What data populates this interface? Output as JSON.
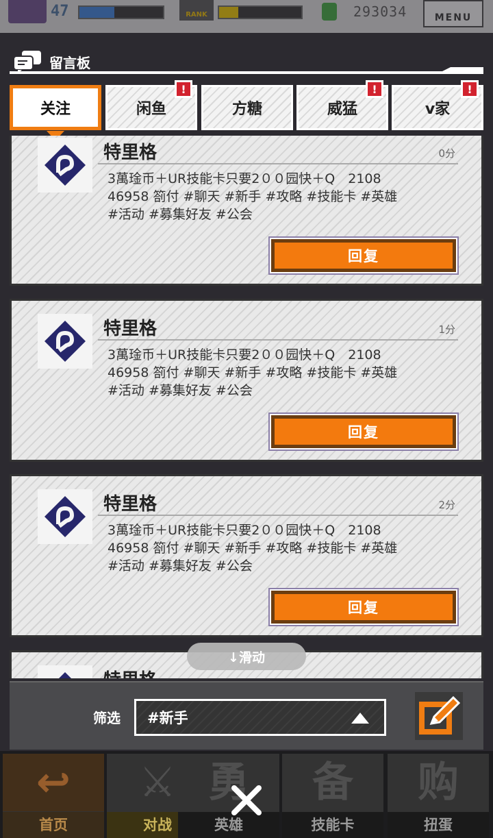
{
  "topbar": {
    "level": "47",
    "rank_label": "RANK",
    "money": "293034",
    "menu_label": "MENU",
    "exp_fill": 0.42,
    "rank_fill": 0.23
  },
  "board": {
    "title": "留言板"
  },
  "tabs": [
    {
      "label": "关注",
      "active": true,
      "alert": false
    },
    {
      "label": "闲鱼",
      "active": false,
      "alert": true
    },
    {
      "label": "方糖",
      "active": false,
      "alert": false
    },
    {
      "label": "威猛",
      "active": false,
      "alert": true
    },
    {
      "label": "v家",
      "active": false,
      "alert": true
    }
  ],
  "alert_glyph": "!",
  "posts": [
    {
      "name": "特里格",
      "time": "0分",
      "line1": "3萬琻币＋UR技能卡只要2００园快＋Q　2108",
      "line2": "46958 箚付 #聊天 #新手 #攻略 #技能卡 #英雄",
      "line3": "#活动 #募集好友 #公会",
      "reply_label": "回复"
    },
    {
      "name": "特里格",
      "time": "1分",
      "line1": "3萬琻币＋UR技能卡只要2００园快＋Q　2108",
      "line2": "46958 箚付 #聊天 #新手 #攻略 #技能卡 #英雄",
      "line3": "#活动 #募集好友 #公会",
      "reply_label": "回复"
    },
    {
      "name": "特里格",
      "time": "2分",
      "line1": "3萬琻币＋UR技能卡只要2００园快＋Q　2108",
      "line2": "46958 箚付 #聊天 #新手 #攻略 #技能卡 #英雄",
      "line3": "#活动 #募集好友 #公会",
      "reply_label": "回复"
    },
    {
      "name": "特里格",
      "time": "",
      "line1": "",
      "line2": "",
      "line3": "",
      "reply_label": ""
    }
  ],
  "scroll_hint": "↓滑动",
  "filter": {
    "label": "筛选",
    "selected": "#新手"
  },
  "nav": [
    {
      "label": "首页",
      "glyph": "↩"
    },
    {
      "label": "对战",
      "glyph": "⚔"
    },
    {
      "label": "英雄",
      "glyph": "勇"
    },
    {
      "label": "技能卡",
      "glyph": "备"
    },
    {
      "label": "扭蛋",
      "glyph": "购"
    }
  ],
  "colors": {
    "accent": "#f07d12",
    "reply_button": "#f37a0e",
    "alert": "#d2222e",
    "avatar_logo": "#27276b"
  }
}
